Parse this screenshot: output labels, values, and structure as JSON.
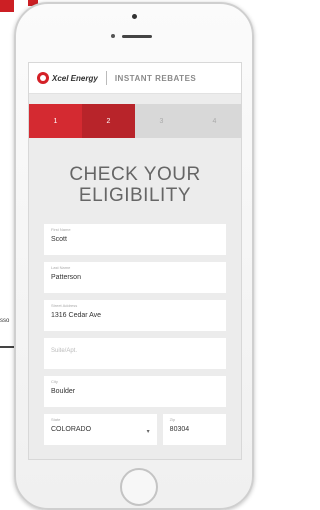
{
  "background": {
    "fragment_text": "sso"
  },
  "header": {
    "brand": "Xcel Energy",
    "title": "INSTANT REBATES"
  },
  "steps": [
    "1",
    "2",
    "3",
    "4"
  ],
  "form": {
    "title_line1": "CHECK YOUR",
    "title_line2": "ELIGIBILITY",
    "fields": {
      "first_name": {
        "label": "First Name",
        "value": "Scott"
      },
      "last_name": {
        "label": "Last Name",
        "value": "Patterson"
      },
      "street": {
        "label": "Street Address",
        "value": "1316 Cedar Ave"
      },
      "suite": {
        "placeholder": "Suite/Apt."
      },
      "city": {
        "label": "City",
        "value": "Boulder"
      },
      "state": {
        "label": "State",
        "value": "COLORADO"
      },
      "zip": {
        "label": "Zip",
        "value": "80304"
      }
    }
  },
  "colors": {
    "accent": "#d42a31",
    "accent_dark": "#b8242a"
  }
}
